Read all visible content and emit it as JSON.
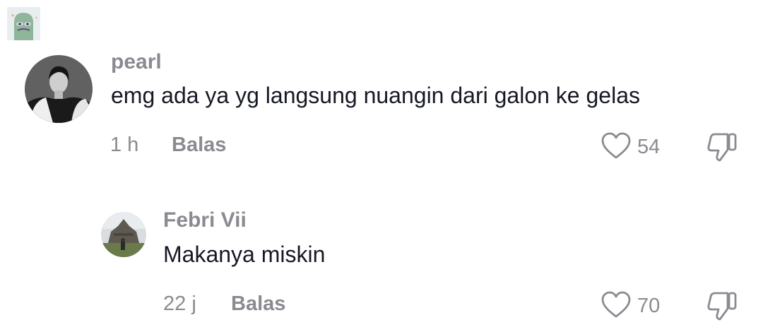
{
  "comments": [
    {
      "username": "pearl",
      "text": "emg ada ya yg langsung nuangin dari galon ke gelas",
      "time": "1 h",
      "reply_label": "Balas",
      "likes": "54",
      "like_icon": "heart-icon",
      "dislike_icon": "thumbs-down-icon"
    },
    {
      "username": "Febri Vii",
      "text": "Makanya miskin",
      "time": "22 j",
      "reply_label": "Balas",
      "likes": "70",
      "like_icon": "heart-icon",
      "dislike_icon": "thumbs-down-icon"
    }
  ]
}
